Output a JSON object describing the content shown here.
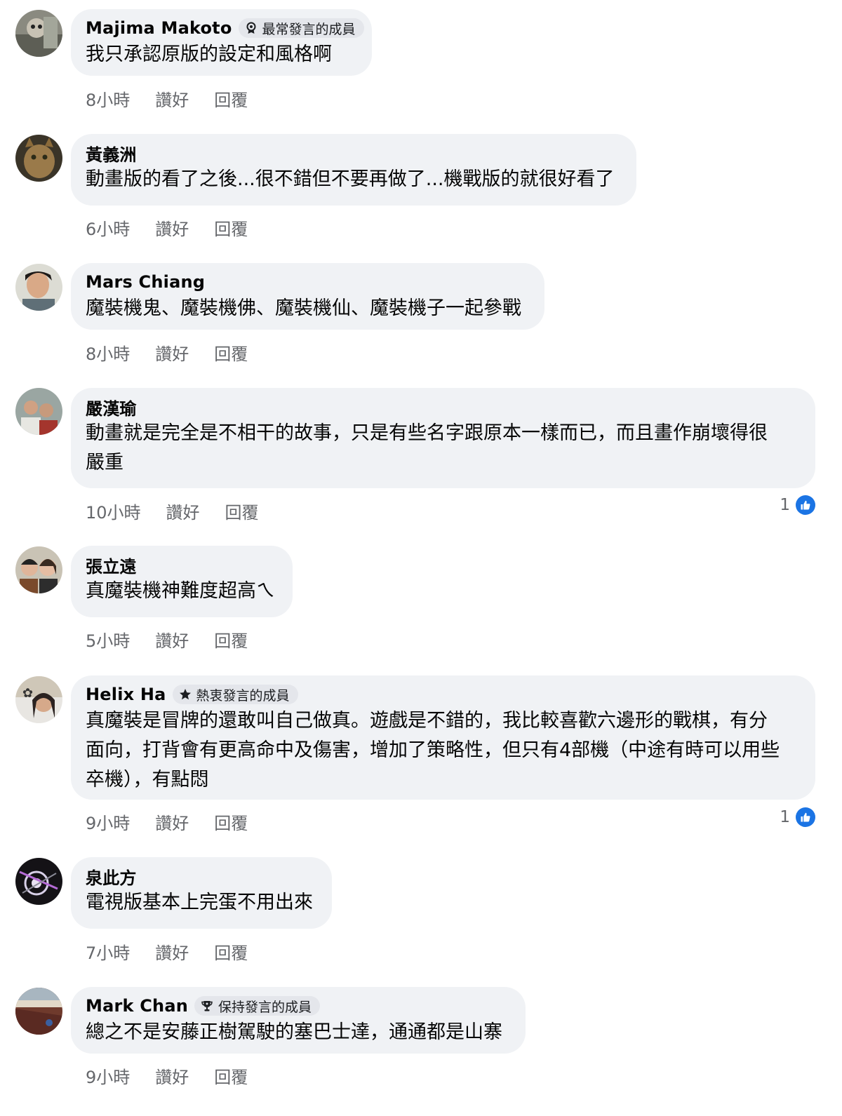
{
  "labels": {
    "like": "讚好",
    "reply": "回覆"
  },
  "colors": {
    "bubble": "#f0f2f5",
    "meta": "#65676b",
    "like_blue": "#1b74e4",
    "badge_bg": "#e4e6eb"
  },
  "comments": [
    {
      "name": "Majima Makoto",
      "badge": "最常發言的成員",
      "badge_icon": "award-icon",
      "text": "我只承認原版的設定和風格啊",
      "time": "8小時",
      "reactions": ""
    },
    {
      "name": "黃義洲",
      "badge": "",
      "text": "動畫版的看了之後...很不錯但不要再做了...機戰版的就很好看了",
      "time": "6小時",
      "reactions": ""
    },
    {
      "name": "Mars Chiang",
      "badge": "",
      "text": "魔裝機鬼、魔裝機佛、魔裝機仙、魔裝機子一起參戰",
      "time": "8小時",
      "reactions": ""
    },
    {
      "name": "嚴漢瑜",
      "badge": "",
      "text": "動畫就是完全是不相干的故事，只是有些名字跟原本一樣而已，而且畫作崩壞得很\n嚴重",
      "time": "10小時",
      "reactions": "1"
    },
    {
      "name": "張立遠",
      "badge": "",
      "text": "真魔裝機神難度超高ㄟ",
      "time": "5小時",
      "reactions": ""
    },
    {
      "name": "Helix Ha",
      "badge": "熱衷發言的成員",
      "badge_icon": "star-icon",
      "text": "真魔裝是冒牌的還敢叫自己做真。遊戲是不錯的，我比較喜歡六邊形的戰棋，有分\n面向，打背會有更高命中及傷害，增加了策略性，但只有4部機（中途有時可以用些\n卒機），有點悶",
      "time": "9小時",
      "reactions": "1"
    },
    {
      "name": "泉此方",
      "badge": "",
      "text": "電視版基本上完蛋不用出來",
      "time": "7小時",
      "reactions": ""
    },
    {
      "name": "Mark Chan",
      "badge": "保持發言的成員",
      "badge_icon": "trophy-icon",
      "text": "總之不是安藤正樹駕駛的塞巴士達，通通都是山寨",
      "time": "9小時",
      "reactions": ""
    }
  ]
}
